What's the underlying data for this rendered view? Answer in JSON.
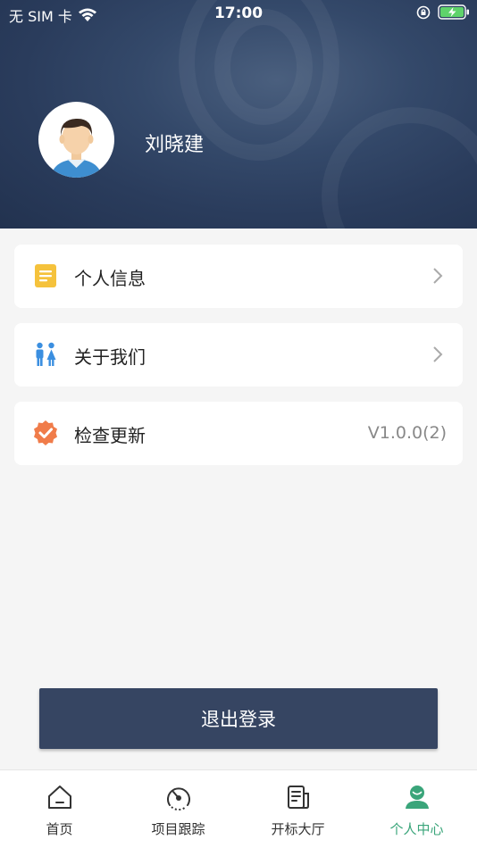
{
  "status_bar": {
    "carrier": "无 SIM 卡",
    "time": "17:00",
    "icons": [
      "wifi-icon",
      "orientation-lock-icon",
      "battery-charging-icon"
    ]
  },
  "profile": {
    "name": "刘晓建",
    "avatar_icon": "user-avatar-icon"
  },
  "menu": [
    {
      "label": "个人信息",
      "icon": "document-icon",
      "icon_color": "#f5c23c"
    },
    {
      "label": "关于我们",
      "icon": "people-icon",
      "icon_color": "#3b8fe0"
    },
    {
      "label": "检查更新",
      "icon": "verified-badge-icon",
      "icon_color": "#f07c4a",
      "value": "V1.0.0(2)"
    }
  ],
  "logout_label": "退出登录",
  "tabbar": {
    "items": [
      {
        "label": "首页",
        "icon": "home-icon"
      },
      {
        "label": "项目跟踪",
        "icon": "gauge-icon"
      },
      {
        "label": "开标大厅",
        "icon": "newspaper-icon"
      },
      {
        "label": "个人中心",
        "icon": "user-icon",
        "active": true
      }
    ],
    "active_color": "#3aa57a"
  },
  "colors": {
    "header": "#2f4263",
    "button": "#364562",
    "background": "#f5f5f5"
  }
}
